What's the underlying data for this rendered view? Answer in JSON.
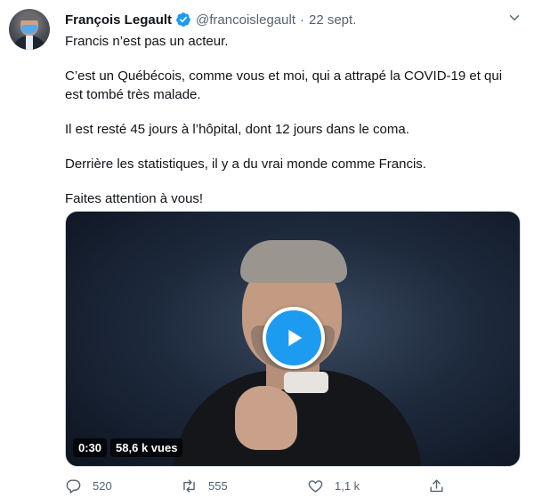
{
  "tweet": {
    "author_name": "François Legault",
    "handle": "@francoislegault",
    "separator": "·",
    "date": "22 sept.",
    "paragraphs": [
      "Francis n’est pas un acteur.",
      "C’est un Québécois, comme vous et moi, qui a attrapé la COVID-19 et qui est tombé très malade.",
      "Il est resté 45 jours à l’hôpital, dont 12 jours dans le coma.",
      "Derrière les statistiques, il y a du vrai monde comme Francis.",
      "Faites attention à vous!"
    ]
  },
  "video": {
    "duration": "0:30",
    "views": "58,6 k vues"
  },
  "actions": {
    "replies": "520",
    "retweets": "555",
    "likes": "1,1 k"
  },
  "colors": {
    "accent": "#1d9bf0",
    "secondary_text": "#536471",
    "primary_text": "#0f1419"
  },
  "icons": {
    "verified": "verified-badge-icon",
    "caret": "chevron-down-icon",
    "play": "play-icon",
    "reply": "reply-icon",
    "retweet": "retweet-icon",
    "like": "heart-icon",
    "share": "share-icon"
  }
}
